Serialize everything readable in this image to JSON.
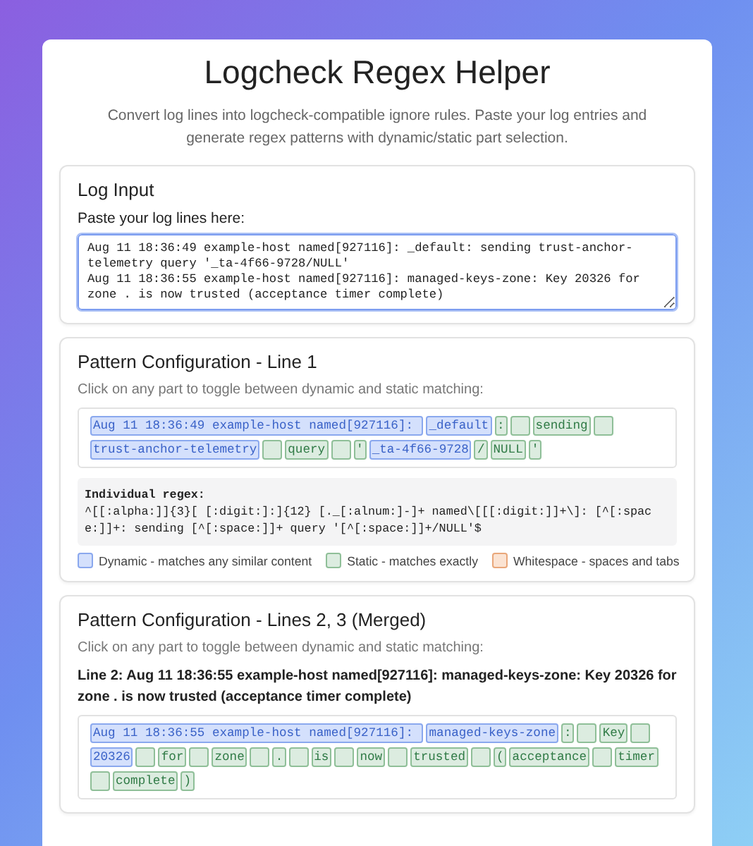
{
  "title": "Logcheck Regex Helper",
  "subtitle": "Convert log lines into logcheck-compatible ignore rules. Paste your log entries and generate regex patterns with dynamic/static part selection.",
  "log_input": {
    "heading": "Log Input",
    "label": "Paste your log lines here:",
    "value": "Aug 11 18:36:49 example-host named[927116]: _default: sending trust-anchor-telemetry query '_ta-4f66-9728/NULL'\nAug 11 18:36:55 example-host named[927116]: managed-keys-zone: Key 20326 for zone . is now trusted (acceptance timer complete)"
  },
  "patterns": [
    {
      "heading": "Pattern Configuration - Line 1",
      "hint": "Click on any part to toggle between dynamic and static matching:",
      "tokens": [
        {
          "kind": "dynamic",
          "text": "Aug 11 18:36:49 example-host named[927116]: "
        },
        {
          "kind": "dynamic",
          "text": "_default"
        },
        {
          "kind": "static",
          "text": ":"
        },
        {
          "kind": "space"
        },
        {
          "kind": "static",
          "text": "sending"
        },
        {
          "kind": "space"
        },
        {
          "kind": "dynamic",
          "text": "trust-anchor-telemetry"
        },
        {
          "kind": "space"
        },
        {
          "kind": "static",
          "text": "query"
        },
        {
          "kind": "space"
        },
        {
          "kind": "static",
          "text": "'"
        },
        {
          "kind": "dynamic",
          "text": "_ta-4f66-9728"
        },
        {
          "kind": "static",
          "text": "/"
        },
        {
          "kind": "static",
          "text": "NULL"
        },
        {
          "kind": "static",
          "text": "'"
        }
      ],
      "regex_label": "Individual regex:",
      "regex": "^[[:alpha:]]{3}[ [:digit:]:]{12} [._[:alnum:]-]+ named\\[[[:digit:]]+\\]: [^[:space:]]+: sending [^[:space:]]+ query '[^[:space:]]+/NULL'$",
      "legend": [
        {
          "kind": "dynamic",
          "text": "Dynamic - matches any similar content"
        },
        {
          "kind": "static",
          "text": "Static - matches exactly"
        },
        {
          "kind": "whitespace",
          "text": "Whitespace - spaces and tabs"
        }
      ]
    },
    {
      "heading": "Pattern Configuration - Lines 2, 3 (Merged)",
      "hint": "Click on any part to toggle between dynamic and static matching:",
      "line_label": "Line 2: Aug 11 18:36:55 example-host named[927116]: managed-keys-zone: Key 20326 for zone . is now trusted (acceptance timer complete)",
      "tokens": [
        {
          "kind": "dynamic",
          "text": "Aug 11 18:36:55 example-host named[927116]: "
        },
        {
          "kind": "dynamic",
          "text": "managed-keys-zone"
        },
        {
          "kind": "static",
          "text": ":"
        },
        {
          "kind": "space"
        },
        {
          "kind": "static",
          "text": "Key"
        },
        {
          "kind": "space"
        },
        {
          "kind": "dynamic",
          "text": "20326"
        },
        {
          "kind": "space"
        },
        {
          "kind": "static",
          "text": "for"
        },
        {
          "kind": "space"
        },
        {
          "kind": "static",
          "text": "zone"
        },
        {
          "kind": "space"
        },
        {
          "kind": "static",
          "text": "."
        },
        {
          "kind": "space"
        },
        {
          "kind": "static",
          "text": "is"
        },
        {
          "kind": "space"
        },
        {
          "kind": "static",
          "text": "now"
        },
        {
          "kind": "space"
        },
        {
          "kind": "static",
          "text": "trusted"
        },
        {
          "kind": "space"
        },
        {
          "kind": "static",
          "text": "("
        },
        {
          "kind": "static",
          "text": "acceptance"
        },
        {
          "kind": "space"
        },
        {
          "kind": "static",
          "text": "timer"
        },
        {
          "kind": "space"
        },
        {
          "kind": "static",
          "text": "complete"
        },
        {
          "kind": "static",
          "text": ")"
        }
      ]
    }
  ]
}
